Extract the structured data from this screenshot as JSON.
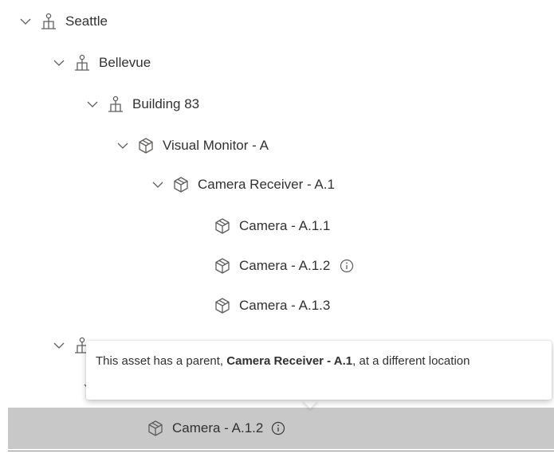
{
  "tree": {
    "items": [
      {
        "label": "Seattle",
        "icon": "location-pin-icon",
        "level": 0,
        "expanded": true
      },
      {
        "label": "Bellevue",
        "icon": "location-pin-icon",
        "level": 1,
        "expanded": true
      },
      {
        "label": "Building 83",
        "icon": "location-pin-icon",
        "level": 2,
        "expanded": true
      },
      {
        "label": "Visual Monitor - A",
        "icon": "asset-cube-icon",
        "level": 3,
        "expanded": true
      },
      {
        "label": "Camera Receiver - A.1",
        "icon": "asset-cube-icon",
        "level": 4,
        "expanded": true
      },
      {
        "label": "Camera - A.1.1",
        "icon": "asset-cube-icon",
        "level": 5
      },
      {
        "label": "Camera - A.1.2",
        "icon": "asset-cube-icon",
        "level": 5,
        "info": true
      },
      {
        "label": "Camera - A.1.3",
        "icon": "asset-cube-icon",
        "level": 5
      }
    ],
    "selected_item": {
      "label": "Camera - A.1.2",
      "icon": "asset-cube-icon",
      "info": true
    }
  },
  "tooltip": {
    "text_before": "This asset has a parent, ",
    "parent_name": "Camera Receiver - A.1",
    "text_after": ", at a different location"
  },
  "colors": {
    "text": "#323130",
    "icon": "#605e5c",
    "selected_row_bg": "#c8c8c8",
    "tooltip_bg": "#ffffff"
  }
}
